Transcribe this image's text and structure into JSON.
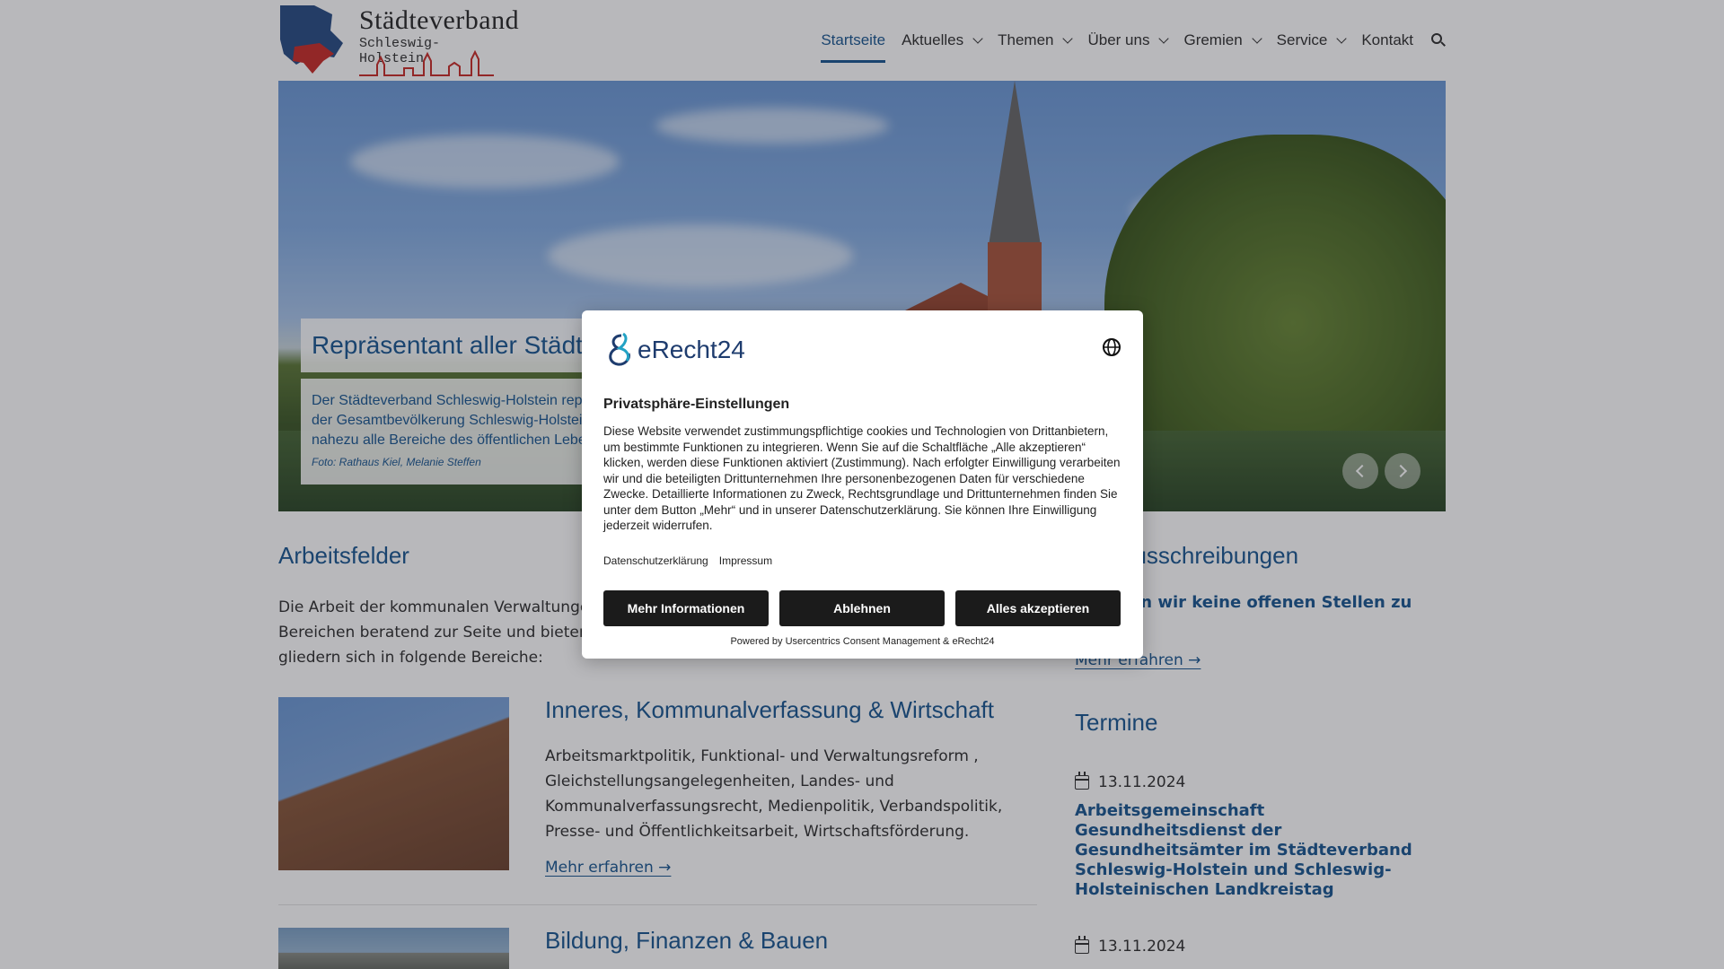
{
  "header": {
    "logo_title": "Städteverband",
    "logo_subtitle": "Schleswig-Holstein",
    "nav": [
      {
        "label": "Startseite",
        "active": true,
        "dropdown": false
      },
      {
        "label": "Aktuelles",
        "active": false,
        "dropdown": true
      },
      {
        "label": "Themen",
        "active": false,
        "dropdown": true
      },
      {
        "label": "Über uns",
        "active": false,
        "dropdown": true
      },
      {
        "label": "Gremien",
        "active": false,
        "dropdown": true
      },
      {
        "label": "Service",
        "active": false,
        "dropdown": true
      },
      {
        "label": "Kontakt",
        "active": false,
        "dropdown": false
      }
    ]
  },
  "hero": {
    "title": "Repräsentant aller Städte",
    "text_line1": "Der Städteverband Schleswig-Holstein repr",
    "text_line2": "der Gesamtbevölkerung Schleswig-Holstein",
    "text_line3": "nahezu alle Bereiche des öffentlichen Lebe",
    "credit": "Foto: Rathaus Kiel, Melanie Steffen"
  },
  "main": {
    "section_title": "Arbeitsfelder",
    "intro_line1": "Die Arbeit der kommunalen Verwaltungen i",
    "intro_line2": "Bereichen beratend zur Seite und bieten ei",
    "intro_line3": "gliedern sich in folgende Bereiche:",
    "cards": [
      {
        "title": "Inneres, Kommunalverfassung & Wirtschaft",
        "text_line1": "Arbeitsmarktpolitik, Funktional- und Verwaltungsreform ,",
        "text_line2": "Gleichstellungsangelegenheiten, Landes- und",
        "text_line3": "Kommunalverfassungsrecht, Medienpolitik, Verbandspolitik,",
        "text_line4": "Presse- und Öffentlichkeitsarbeit, Wirtschaftsförderung.",
        "link": "Mehr erfahren →"
      },
      {
        "title": "Bildung, Finanzen & Bauen"
      }
    ]
  },
  "sidebar": {
    "jobs_title": "ausschreibungen",
    "jobs_text_line1": "aben wir keine offenen Stellen zu",
    "jobs_link": "Mehr erfahren →",
    "events_title": "Termine",
    "events": [
      {
        "date": "13.11.2024",
        "title_line1": "Arbeitsgemeinschaft Gesundheitsdienst der",
        "title_line2": "Gesundheitsämter im Städteverband",
        "title_line3": "Schleswig-Holstein und Schleswig-",
        "title_line4": "Holsteinischen Landkreistag"
      },
      {
        "date": "13.11.2024"
      }
    ]
  },
  "consent": {
    "brand": "eRecht24",
    "heading": "Privatsphäre-Einstellungen",
    "text": "Diese Website verwendet zustimmungspflichtige cookies und Technologien von Drittanbietern, um bestimmte Funktionen zu integrieren. Wenn Sie auf die Schaltfläche „Alle akzeptieren“ klicken, werden diese Funktionen aktiviert (Zustimmung). Nach erfolgter Einwilligung verarbeiten wir und die beteiligten Drittunternehmen Ihre personenbezogenen Daten für verschiedene Zwecke. Detaillierte Informationen zu Zweck, Rechtsgrundlage und Drittunternehmen finden Sie unter dem Button „Mehr“ und in unserer Datenschutzerklärung. Sie können Ihre Einwilligung jederzeit widerrufen.",
    "link_privacy": "Datenschutzerklärung",
    "link_imprint": "Impressum",
    "btn_more": "Mehr Informationen",
    "btn_decline": "Ablehnen",
    "btn_accept": "Alles akzeptieren",
    "powered": "Powered by Usercentrics Consent Management & eRecht24"
  },
  "colors": {
    "accent": "#1d5a92",
    "button_dark": "#1b1b1b"
  }
}
